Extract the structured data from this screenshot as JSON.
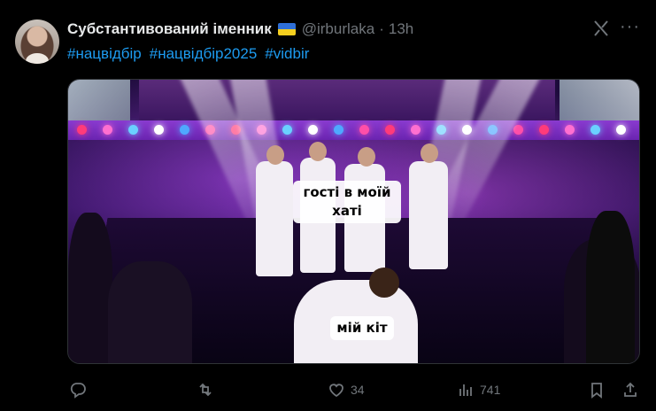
{
  "tweet": {
    "author_name": "Субстантивований іменник",
    "flag_emoji": "ukraine-flag",
    "handle": "@irburlaka",
    "separator": "·",
    "time": "13h",
    "hashtags": [
      "#нацвідбір",
      "#нацвідбір2025",
      "#vidbir"
    ],
    "media": {
      "caption_top": "гості в моїй\nхаті",
      "caption_top_line1": "гості в моїй",
      "caption_top_line2": "хаті",
      "caption_bottom": "мій кіт"
    },
    "actions": {
      "reply_icon": "reply-icon",
      "retweet_icon": "retweet-icon",
      "like_icon": "heart-icon",
      "like_count": "34",
      "views_icon": "views-icon",
      "views_count": "741",
      "bookmark_icon": "bookmark-icon",
      "share_icon": "share-icon"
    },
    "more_icon": "more-icon",
    "grok_icon": "grok-icon"
  },
  "colors": {
    "background": "#000000",
    "link": "#1d9bf0",
    "muted": "#71767b",
    "text": "#e7e9ea"
  }
}
